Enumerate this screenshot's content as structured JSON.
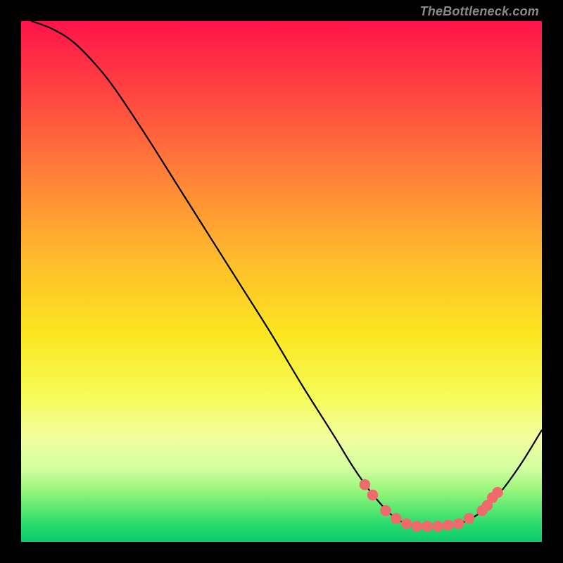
{
  "watermark": {
    "text": "TheBottleneck.com"
  },
  "colors": {
    "black": "#000000",
    "curve": "#000000",
    "dot": "#ef6b6b",
    "watermark": "#888888"
  },
  "chart_data": {
    "type": "line",
    "title": "",
    "xlabel": "",
    "ylabel": "",
    "xlim": [
      0,
      100
    ],
    "ylim": [
      0,
      100
    ],
    "grid": false,
    "legend": false,
    "background_gradient": {
      "stops": [
        {
          "offset": 0,
          "color": "#ff134a"
        },
        {
          "offset": 14,
          "color": "#ff4542"
        },
        {
          "offset": 30,
          "color": "#ff8338"
        },
        {
          "offset": 46,
          "color": "#ffbc2c"
        },
        {
          "offset": 60,
          "color": "#fbe61f"
        },
        {
          "offset": 72,
          "color": "#f6fb58"
        },
        {
          "offset": 80,
          "color": "#f2fe9e"
        },
        {
          "offset": 86,
          "color": "#d2fea0"
        },
        {
          "offset": 90,
          "color": "#99f67d"
        },
        {
          "offset": 94,
          "color": "#55e770"
        },
        {
          "offset": 97,
          "color": "#24d96d"
        },
        {
          "offset": 100,
          "color": "#0acb68"
        }
      ]
    },
    "series": [
      {
        "name": "curve",
        "points": [
          {
            "x": 2.0,
            "y": 100.0
          },
          {
            "x": 6.0,
            "y": 98.5
          },
          {
            "x": 10.0,
            "y": 96.0
          },
          {
            "x": 14.0,
            "y": 92.0
          },
          {
            "x": 18.0,
            "y": 87.0
          },
          {
            "x": 24.0,
            "y": 78.0
          },
          {
            "x": 30.0,
            "y": 68.5
          },
          {
            "x": 36.0,
            "y": 59.0
          },
          {
            "x": 42.0,
            "y": 49.5
          },
          {
            "x": 48.0,
            "y": 40.0
          },
          {
            "x": 54.0,
            "y": 30.0
          },
          {
            "x": 60.0,
            "y": 20.5
          },
          {
            "x": 64.0,
            "y": 14.0
          },
          {
            "x": 68.0,
            "y": 8.5
          },
          {
            "x": 72.0,
            "y": 4.5
          },
          {
            "x": 76.0,
            "y": 3.0
          },
          {
            "x": 80.0,
            "y": 3.0
          },
          {
            "x": 84.0,
            "y": 3.5
          },
          {
            "x": 88.0,
            "y": 5.5
          },
          {
            "x": 92.0,
            "y": 9.5
          },
          {
            "x": 96.0,
            "y": 15.0
          },
          {
            "x": 100.0,
            "y": 21.5
          }
        ]
      }
    ],
    "dots": [
      {
        "x": 66.0,
        "y": 11.0
      },
      {
        "x": 67.5,
        "y": 9.0
      },
      {
        "x": 70.0,
        "y": 6.0
      },
      {
        "x": 72.0,
        "y": 4.5
      },
      {
        "x": 74.0,
        "y": 3.5
      },
      {
        "x": 76.0,
        "y": 3.0
      },
      {
        "x": 78.0,
        "y": 3.0
      },
      {
        "x": 80.0,
        "y": 3.0
      },
      {
        "x": 82.0,
        "y": 3.2
      },
      {
        "x": 84.0,
        "y": 3.5
      },
      {
        "x": 86.0,
        "y": 4.5
      },
      {
        "x": 88.5,
        "y": 6.0
      },
      {
        "x": 89.5,
        "y": 7.0
      },
      {
        "x": 90.5,
        "y": 8.5
      },
      {
        "x": 91.5,
        "y": 9.5
      }
    ]
  }
}
